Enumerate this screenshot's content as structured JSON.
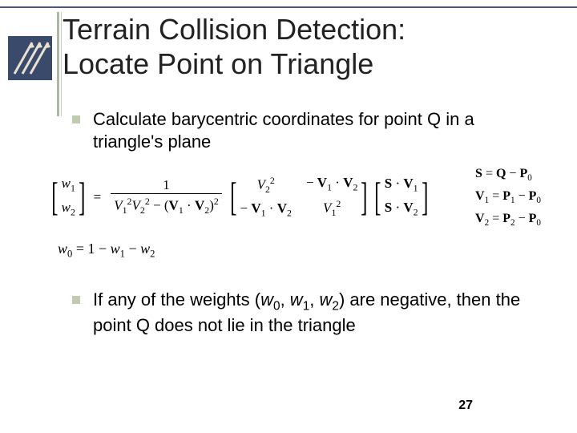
{
  "title_line1": "Terrain Collision Detection:",
  "title_line2": "Locate Point on Triangle",
  "bullet1": "Calculate barycentric coordinates for point Q in a triangle's plane",
  "bullet2_pre": "If any of the weights (",
  "bullet2_w0": "w",
  "bullet2_s0": "0",
  "bullet2_c1": ", ",
  "bullet2_w1": "w",
  "bullet2_s1": "1",
  "bullet2_c2": ", ",
  "bullet2_w2": "w",
  "bullet2_s2": "2",
  "bullet2_post": ") are negative, then the point Q does not lie in the triangle",
  "math": {
    "lhs_r1": "w₁",
    "lhs_r2": "w₂",
    "frac_num": "1",
    "frac_den": "V₁²V₂² − (V₁ · V₂)²",
    "m11": "V₂²",
    "m12": "− V₁ · V₂",
    "m21": "− V₁ · V₂",
    "m22": "V₁²",
    "rhs_r1": "S · V₁",
    "rhs_r2": "S · V₂",
    "w0": "w₀ = 1 − w₁ − w₂",
    "def_S": "S = Q − P₀",
    "def_V1": "V₁ = P₁ − P₀",
    "def_V2": "V₂ = P₂ − P₀"
  },
  "pagenum": "27"
}
